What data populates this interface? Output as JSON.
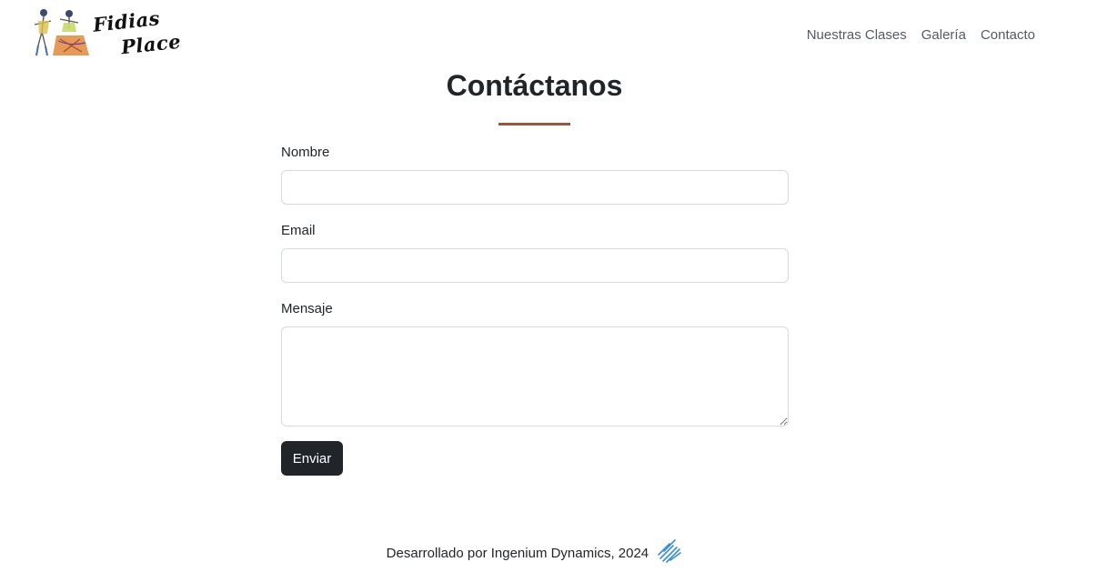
{
  "header": {
    "logo_line1": "Fidias",
    "logo_line2": "Place",
    "nav": [
      "Nuestras Clases",
      "Galería",
      "Contacto"
    ]
  },
  "main": {
    "title": "Contáctanos",
    "form": {
      "name_label": "Nombre",
      "name_value": "",
      "email_label": "Email",
      "email_value": "",
      "message_label": "Mensaje",
      "message_value": "",
      "submit_label": "Enviar"
    }
  },
  "footer": {
    "text": "Desarrollado por Ingenium Dynamics, 2024"
  },
  "colors": {
    "accent_underline": "#a0523a",
    "button_bg": "#212529",
    "brand_mark": "#3a8fd0"
  },
  "icons": [
    "dancers-logo-illustration",
    "ingenium-dynamics-logo-icon"
  ]
}
